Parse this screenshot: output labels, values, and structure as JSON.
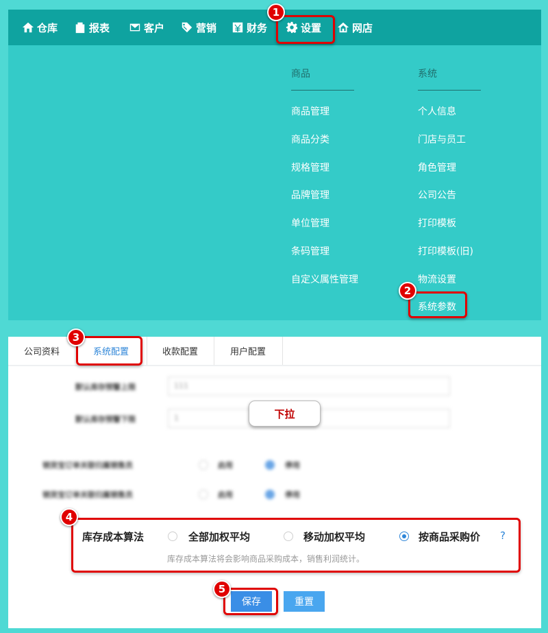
{
  "nav": {
    "items": [
      {
        "label": "仓库",
        "icon": "home-icon"
      },
      {
        "label": "报表",
        "icon": "clipboard-icon"
      },
      {
        "label": "客户",
        "icon": "envelope-icon"
      },
      {
        "label": "营销",
        "icon": "tag-icon"
      },
      {
        "label": "财务",
        "icon": "yen-icon"
      },
      {
        "label": "设置",
        "icon": "gear-icon"
      },
      {
        "label": "网店",
        "icon": "house-outline-icon"
      }
    ]
  },
  "dropdown": {
    "products": {
      "header": "商品",
      "items": [
        "商品管理",
        "商品分类",
        "规格管理",
        "品牌管理",
        "单位管理",
        "条码管理",
        "自定义属性管理"
      ]
    },
    "system": {
      "header": "系统",
      "items": [
        "个人信息",
        "门店与员工",
        "角色管理",
        "公司公告",
        "打印模板",
        "打印模板(旧)",
        "物流设置",
        "系统参数"
      ]
    }
  },
  "tabs": [
    "公司资料",
    "系统配置",
    "收款配置",
    "用户配置"
  ],
  "blurred": {
    "row1_label": "默认库存预警上限",
    "row1_value": "111",
    "row2_label": "默认库存预警下限",
    "row2_value": "1",
    "row3_label": "销货宝订单关联归属销售员",
    "row4_label": "销货宝订单关联归属销售员",
    "enable": "启用",
    "disable": "停用"
  },
  "callout": "下拉",
  "cost": {
    "title": "库存成本算法",
    "options": [
      "全部加权平均",
      "移动加权平均",
      "按商品采购价"
    ],
    "selected": 2,
    "help": "?",
    "hint": "库存成本算法将会影响商品采购成本，销售利润统计。"
  },
  "buttons": {
    "save": "保存",
    "reset": "重置"
  },
  "badges": [
    "1",
    "2",
    "3",
    "4",
    "5"
  ]
}
